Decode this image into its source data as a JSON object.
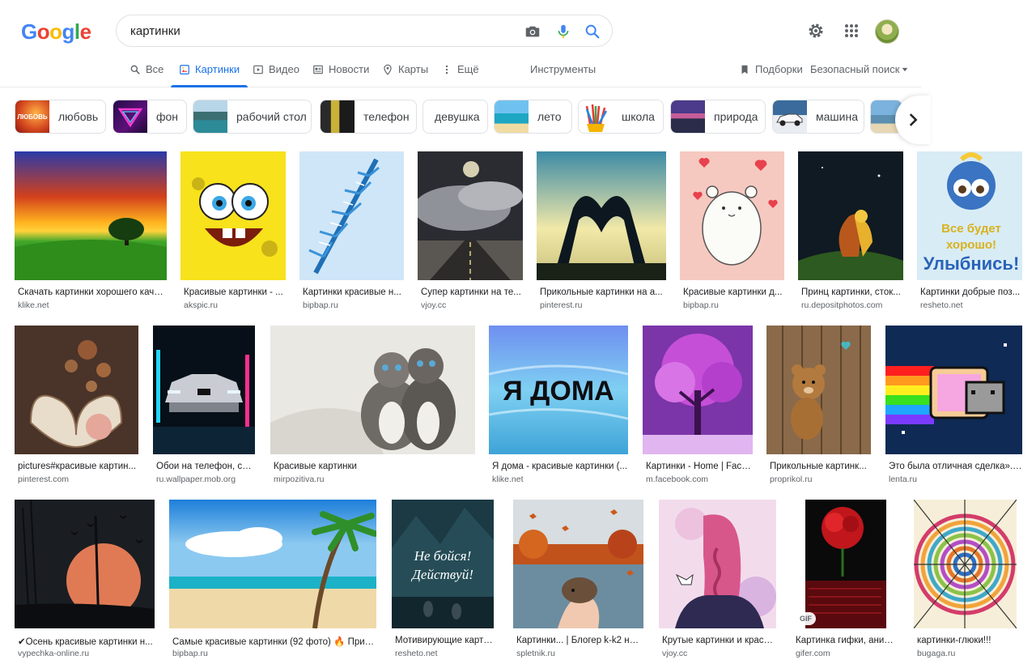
{
  "search": {
    "query": "картинки"
  },
  "logo": {
    "letters": [
      "G",
      "o",
      "o",
      "g",
      "l",
      "e"
    ]
  },
  "header_icons": [
    "camera-icon",
    "microphone-icon",
    "search-icon",
    "gear-icon",
    "apps-grid-icon"
  ],
  "tabs": {
    "all": "Все",
    "images": "Картинки",
    "video": "Видео",
    "news": "Новости",
    "maps": "Карты",
    "more": "Ещё",
    "tools": "Инструменты",
    "collections": "Подборки",
    "safesearch": "Безопасный поиск"
  },
  "chips": [
    "любовь",
    "фон",
    "рабочий стол",
    "телефон",
    "девушка",
    "лето",
    "школа",
    "природа",
    "машина"
  ],
  "chip_thumb_text": {
    "love": "ЛЮБОВЬ"
  },
  "results": [
    {
      "title": "Скачать картинки хорошего каче...",
      "source": "klike.net"
    },
    {
      "title": "Красивые картинки - ...",
      "source": "akspic.ru"
    },
    {
      "title": "Картинки красивые н...",
      "source": "bipbap.ru"
    },
    {
      "title": "Супер картинки на те...",
      "source": "vjoy.cc"
    },
    {
      "title": "Прикольные картинки на а...",
      "source": "pinterest.ru"
    },
    {
      "title": "Красивые картинки д...",
      "source": "bipbap.ru"
    },
    {
      "title": "Принц картинки, сток...",
      "source": "ru.depositphotos.com"
    },
    {
      "title": "Картинки добрые поз...",
      "source": "resheto.net"
    },
    {
      "title": "pictures#красивые картин...",
      "source": "pinterest.com"
    },
    {
      "title": "Обои на телефон, ска...",
      "source": "ru.wallpaper.mob.org"
    },
    {
      "title": "Красивые картинки",
      "source": "mirpozitiva.ru"
    },
    {
      "title": "Я дома - красивые картинки (...",
      "source": "klike.net"
    },
    {
      "title": "Картинки - Home | Face...",
      "source": "m.facebook.com"
    },
    {
      "title": "Прикольные картинк...",
      "source": "proprikol.ru"
    },
    {
      "title": "Это была отличная сделка». ...",
      "source": "lenta.ru"
    },
    {
      "title": "✔Осень красивые картинки н...",
      "source": "vypechka-online.ru"
    },
    {
      "title": "Самые красивые картинки (92 фото) 🔥 Прико...",
      "source": "bipbap.ru"
    },
    {
      "title": "Мотивирующие карти...",
      "source": "resheto.net"
    },
    {
      "title": "Картинки... | Блогер k-k2 на ...",
      "source": "spletnik.ru"
    },
    {
      "title": "Крутые картинки и краси...",
      "source": "vjoy.cc"
    },
    {
      "title": "Картинка гифки, аним...",
      "source": "gifer.com"
    },
    {
      "title": "картинки-глюки!!!",
      "source": "bugaga.ru"
    }
  ],
  "image_texts": {
    "positive_line1": "Все будет",
    "positive_line2": "хорошо!",
    "positive_line3": "Улыбнись!",
    "home": "Я ДОМА",
    "motiv_line1": "Не бойся!",
    "motiv_line2": "Действуй!",
    "gif_badge": "GIF"
  },
  "colors": {
    "accent": "#1a73e8",
    "text": "#202124",
    "secondary": "#5f6368",
    "border": "#dfe1e5"
  }
}
